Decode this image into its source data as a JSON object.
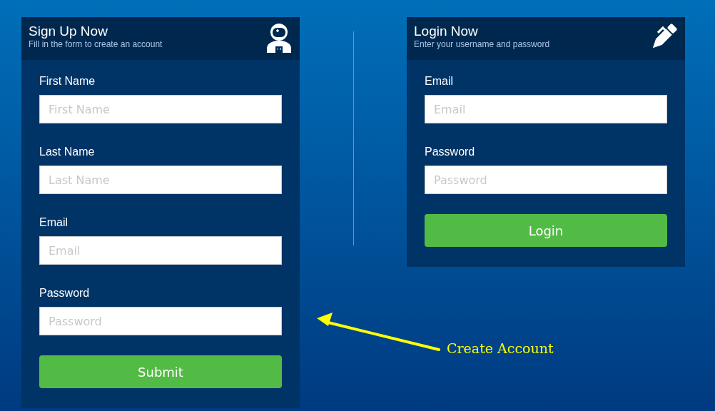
{
  "signup": {
    "title": "Sign Up Now",
    "subtitle": "Fill in the form to create an account",
    "fields": [
      {
        "label": "First Name",
        "placeholder": "First Name"
      },
      {
        "label": "Last Name",
        "placeholder": "Last Name"
      },
      {
        "label": "Email",
        "placeholder": "Email"
      },
      {
        "label": "Password",
        "placeholder": "Password"
      }
    ],
    "button": "Submit"
  },
  "login": {
    "title": "Login Now",
    "subtitle": "Enter your username and password",
    "fields": [
      {
        "label": "Email",
        "placeholder": "Email"
      },
      {
        "label": "Password",
        "placeholder": "Password"
      }
    ],
    "button": "Login"
  },
  "annotation": {
    "text": "Create Account"
  }
}
